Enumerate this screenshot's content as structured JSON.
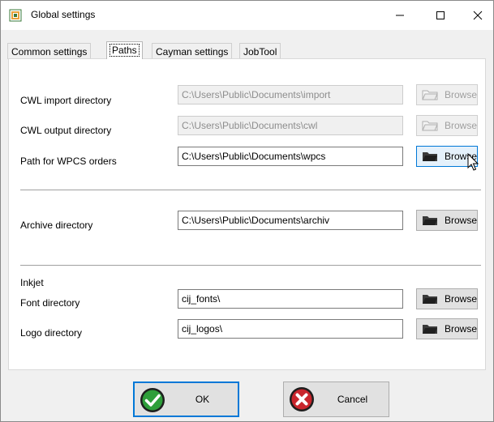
{
  "window": {
    "title": "Global settings"
  },
  "tabs": [
    {
      "label": "Common settings",
      "active": false
    },
    {
      "label": "Paths",
      "active": true
    },
    {
      "label": "Cayman settings",
      "active": false
    },
    {
      "label": "JobTool",
      "active": false
    }
  ],
  "paths": {
    "cwl_import": {
      "label": "CWL import directory",
      "value": "C:\\Users\\Public\\Documents\\import",
      "enabled": false
    },
    "cwl_output": {
      "label": "CWL output directory",
      "value": "C:\\Users\\Public\\Documents\\cwl",
      "enabled": false
    },
    "wpcs_orders": {
      "label": "Path for WPCS orders",
      "value": "C:\\Users\\Public\\Documents\\wpcs",
      "enabled": true
    },
    "archive": {
      "label": "Archive directory",
      "value": "C:\\Users\\Public\\Documents\\archiv",
      "enabled": true
    },
    "inkjet_heading": "Inkjet",
    "font_dir": {
      "label": "Font directory",
      "value": "cij_fonts\\",
      "enabled": true
    },
    "logo_dir": {
      "label": "Logo directory",
      "value": "cij_logos\\",
      "enabled": true
    },
    "browse_label": "Browse"
  },
  "buttons": {
    "ok_label": "OK",
    "cancel_label": "Cancel"
  },
  "colors": {
    "accent": "#0078d7",
    "ok_green": "#2e9e3a",
    "cancel_red": "#c9252c"
  },
  "icons": [
    "app-icon",
    "minimize-icon",
    "maximize-icon",
    "close-icon",
    "folder-icon",
    "checkmark-icon",
    "cancel-x-icon",
    "mouse-cursor-icon"
  ]
}
